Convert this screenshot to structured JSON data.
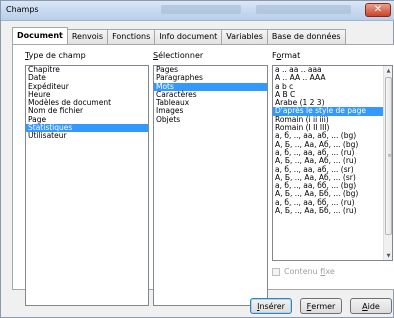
{
  "window": {
    "title": "Champs"
  },
  "tabs": [
    {
      "label": "Document",
      "active": true
    },
    {
      "label": "Renvois",
      "active": false
    },
    {
      "label": "Fonctions",
      "active": false
    },
    {
      "label": "Info document",
      "active": false
    },
    {
      "label": "Variables",
      "active": false
    },
    {
      "label": "Base de données",
      "active": false
    }
  ],
  "columns": {
    "type": {
      "label_first": "T",
      "label_rest": "ype de champ"
    },
    "select": {
      "label_first": "S",
      "label_rest": "électionner"
    },
    "format": {
      "label_first": "F",
      "label_mid": "o",
      "label_rest": "rmat"
    }
  },
  "type_list": {
    "items": [
      "Chapitre",
      "Date",
      "Expéditeur",
      "Heure",
      "Modèles de document",
      "Nom de fichier",
      "Page",
      "Statistiques",
      "Utilisateur"
    ],
    "selected": "Statistiques"
  },
  "select_list": {
    "items": [
      "Pages",
      "Paragraphes",
      "Mots",
      "Caractères",
      "Tableaux",
      "Images",
      "Objets"
    ],
    "selected": "Mots"
  },
  "format_list": {
    "items": [
      "a .. aa .. aaa",
      "A .. AA .. AAA",
      "a b c",
      "A B C",
      "Arabe (1 2 3)",
      "D'après le style de page",
      "Romain (i ii iii)",
      "Romain (I II III)",
      "a, б, .., aa, aб, ... (bg)",
      "A, Б, .., Aa, Aб, ... (bg)",
      "a, б, .., aa, aб, ... (ru)",
      "A, Б, .., Aa, Aб, ... (ru)",
      "a, б, .., aa, aб, ... (sr)",
      "A, Б, .., Aa, Aб, ... (sr)",
      "a, б, .., aa, бб, ... (bg)",
      "A, Б, .., Aa, Бб, ... (bg)",
      "a, б, .., aa, бб, ... (ru)",
      "A, Б, .., Aa, Бб, ... (ru)"
    ],
    "selected": "D'après le style de page"
  },
  "checkbox": {
    "label_first": "Contenu ",
    "label_underlined": "f",
    "label_rest": "ixe",
    "checked": false,
    "enabled": false
  },
  "buttons": {
    "insert": {
      "u": "I",
      "rest": "nsérer"
    },
    "close": {
      "u": "F",
      "rest": "ermer"
    },
    "help": {
      "u": "A",
      "rest": "ide"
    }
  }
}
